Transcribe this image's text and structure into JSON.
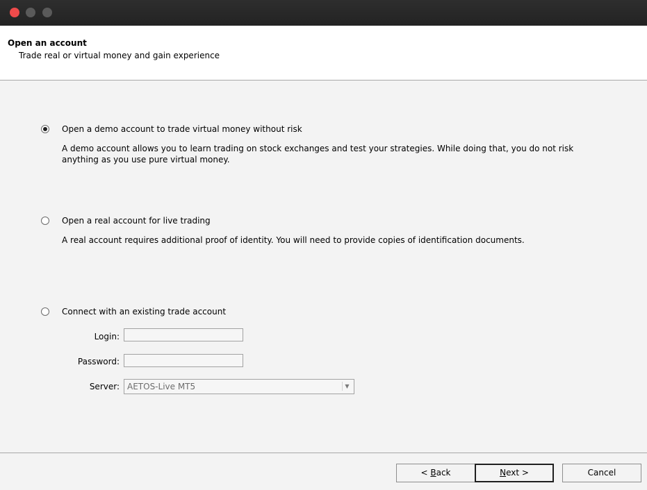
{
  "header": {
    "title": "Open an account",
    "subtitle": "Trade real or virtual money and gain experience"
  },
  "options": [
    {
      "label": "Open a demo account to trade virtual money without risk",
      "description": "A demo account allows you to learn trading on stock exchanges and test your strategies. While doing that, you do not risk anything as you use pure virtual money.",
      "selected": true
    },
    {
      "label": "Open a real account for live trading",
      "description": "A real account requires additional proof of identity. You will need to provide copies of identification documents.",
      "selected": false
    },
    {
      "label": "Connect with an existing trade account",
      "selected": false
    }
  ],
  "form": {
    "login_label": "Login:",
    "login_value": "",
    "password_label": "Password:",
    "password_value": "",
    "server_label": "Server:",
    "server_value": "AETOS-Live MT5"
  },
  "buttons": {
    "back_prefix": "< ",
    "back_key": "B",
    "back_rest": "ack",
    "next_key": "N",
    "next_rest": "ext >",
    "cancel": "Cancel"
  },
  "colors": {
    "close": "#ee4b4b",
    "titlebar": "#2a2a2a",
    "background": "#f3f3f3"
  }
}
